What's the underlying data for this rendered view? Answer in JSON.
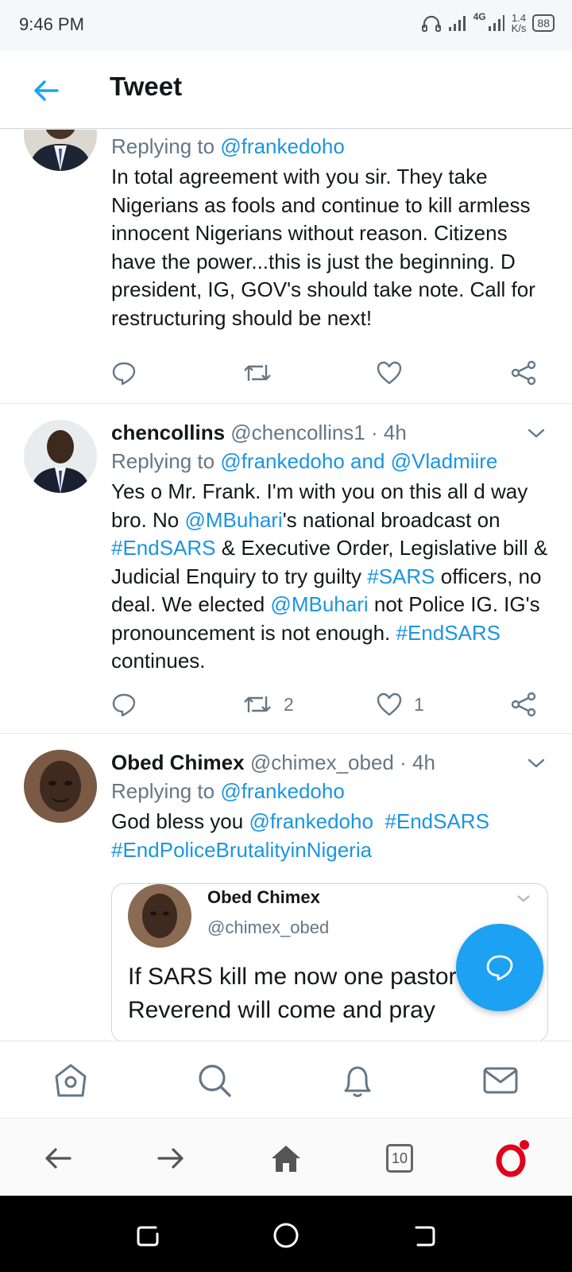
{
  "status": {
    "time": "9:46 PM",
    "network": "4G",
    "speed_value": "1.4",
    "speed_unit": "K/s",
    "battery": "88"
  },
  "header": {
    "title": "Tweet"
  },
  "tweets": [
    {
      "reply_prefix": "Replying to ",
      "reply_to": "@frankedoho",
      "text": "In total agreement with you sir. They take Nigerians as fools and continue to kill armless innocent Nigerians without reason. Citizens have the power...this is just the beginning. D president, IG, GOV's should take note. Call for restructuring should be next!",
      "retweets": "",
      "likes": ""
    },
    {
      "name": "chencollins",
      "handle": "@chencollins1",
      "time": "· 4h",
      "reply_prefix": "Replying to ",
      "reply_to": "@frankedoho and @Vladmiire",
      "text_parts": [
        "Yes o Mr. Frank. I'm with you on this all d way bro. No ",
        "@MBuhari",
        "'s national broadcast on ",
        "#EndSARS",
        " & Executive Order, Legislative bill & Judicial Enquiry to try guilty ",
        "#SARS",
        " officers, no deal. We elected ",
        "@MBuhari",
        " not Police IG. IG's pronouncement is not enough. ",
        "#EndSARS",
        " continues."
      ],
      "retweets": "2",
      "likes": "1"
    },
    {
      "name": "Obed Chimex",
      "handle": "@chimex_obed",
      "time": "· 4h",
      "reply_prefix": "Replying to ",
      "reply_to": "@frankedoho",
      "text_parts": [
        "God bless you ",
        "@frankedoho",
        "  ",
        "#EndSARS",
        " ",
        "#EndPoliceBrutalityinNigeria"
      ],
      "quote": {
        "name": "Obed Chimex",
        "handle": "@chimex_obed",
        "text": "If SARS kill me now one pastor a  Reverend will come and pray"
      }
    }
  ],
  "bottom_tabs": [
    "home-icon",
    "search-icon",
    "notifications-icon",
    "messages-icon"
  ],
  "browser": {
    "tab_count": "10"
  },
  "colors": {
    "accent": "#1da1f2",
    "link": "#1b95e0",
    "muted": "#657786",
    "opera": "#e0001b"
  }
}
